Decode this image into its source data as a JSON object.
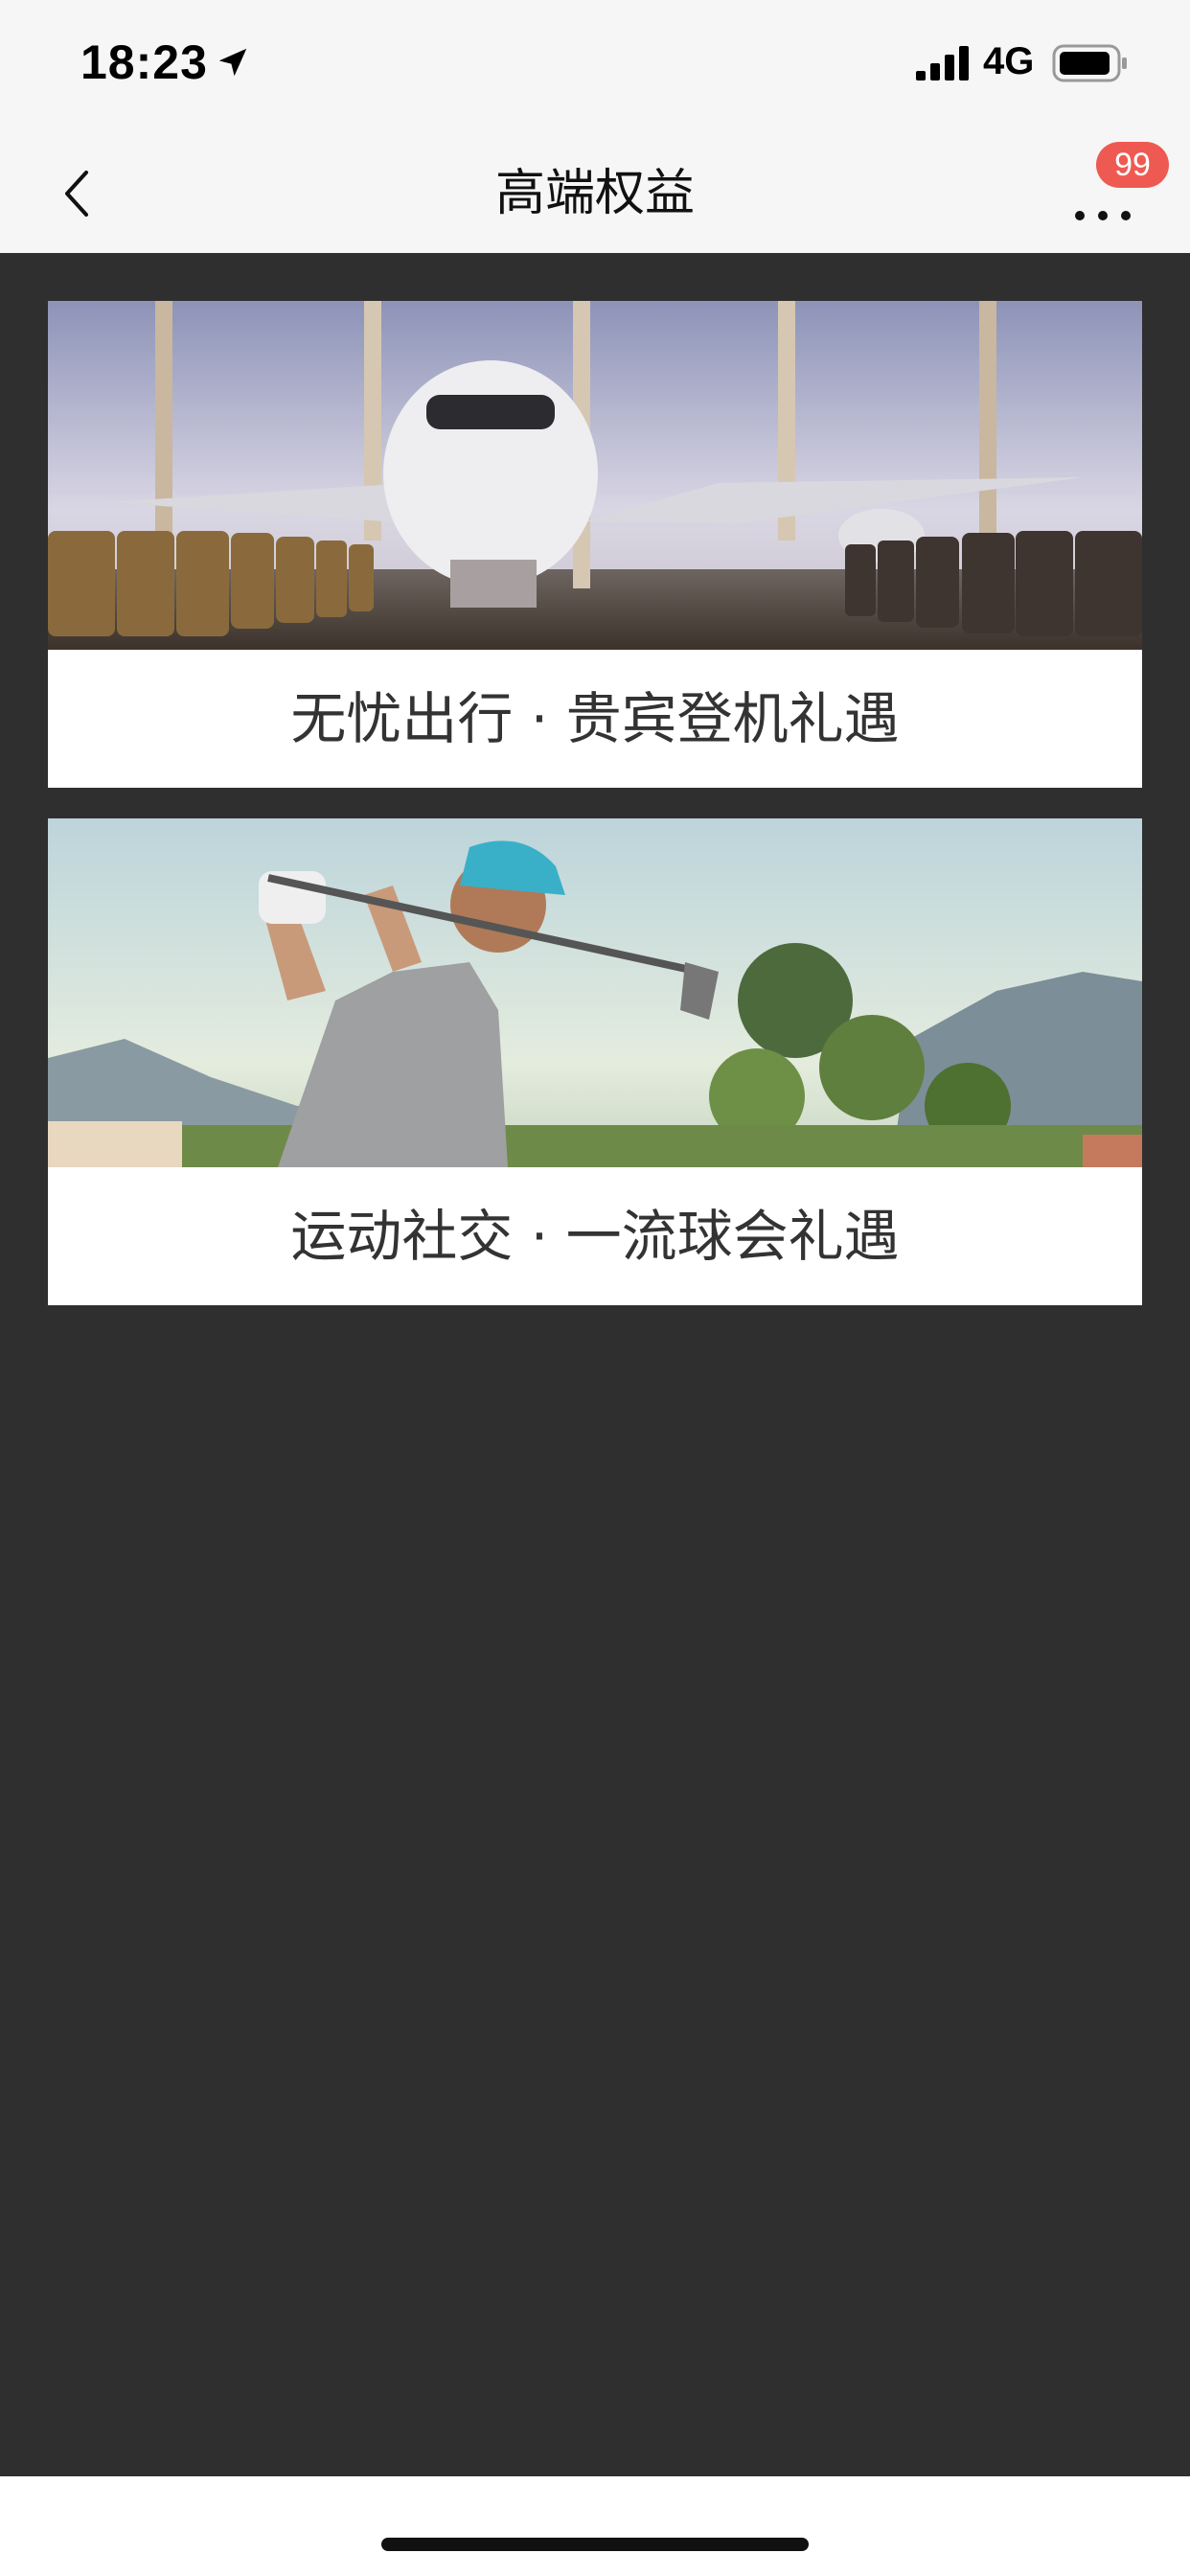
{
  "status_bar": {
    "time": "18:23",
    "network": "4G",
    "icons": [
      "location-arrow-icon",
      "signal-bars-icon",
      "battery-icon"
    ]
  },
  "nav": {
    "title": "高端权益",
    "back_icon": "chevron-left-icon",
    "more_icon": "more-dots-icon",
    "badge_count": "99",
    "badge_color": "#ee5a52"
  },
  "cards": [
    {
      "caption": "无忧出行 · 贵宾登机礼遇",
      "image": "airport-lounge-airplane-photo"
    },
    {
      "caption": "运动社交 · 一流球会礼遇",
      "image": "golfer-swing-photo"
    }
  ],
  "colors": {
    "background": "#2f2f30",
    "bar": "#f6f6f6",
    "caption_text": "#333333"
  }
}
